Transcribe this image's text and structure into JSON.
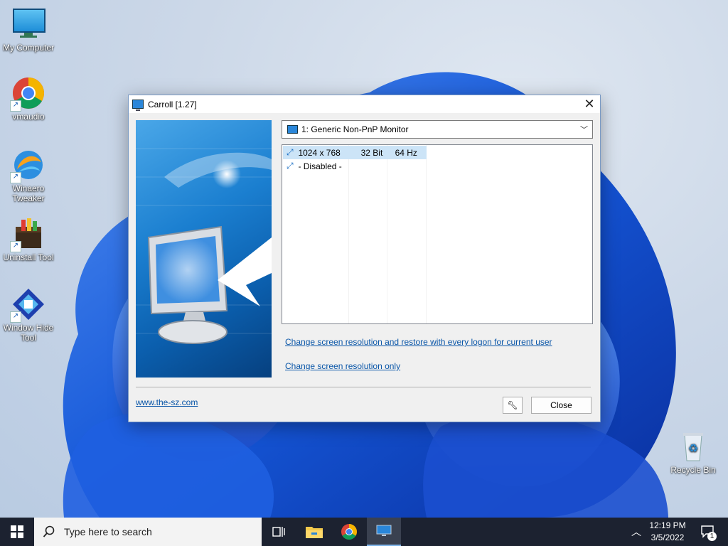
{
  "desktop": {
    "icons": [
      {
        "label": "My Computer",
        "icon": "monitor-icon"
      },
      {
        "label": "vmaudio",
        "icon": "chrome-icon"
      },
      {
        "label": "Winaero Tweaker",
        "icon": "winaero-icon"
      },
      {
        "label": "Uninstall Tool",
        "icon": "uninstall-tool-icon"
      },
      {
        "label": "Window Hide Tool",
        "icon": "window-hide-tool-icon"
      },
      {
        "label": "Recycle Bin",
        "icon": "recycle-bin-icon"
      }
    ]
  },
  "dialog": {
    "title": "Carroll [1.27]",
    "monitor_select": {
      "value": "1: Generic Non-PnP Monitor"
    },
    "resolutions": [
      {
        "res": "1024 x 768",
        "depth": "32 Bit",
        "hz": "64 Hz",
        "selected": true
      },
      {
        "res": "- Disabled -",
        "depth": "",
        "hz": "",
        "selected": false
      }
    ],
    "link_restore": "Change screen resolution and restore with every logon for current user",
    "link_only": "Change screen resolution only",
    "website": "www.the-sz.com",
    "close_button": "Close"
  },
  "taskbar": {
    "search_placeholder": "Type here to search",
    "time": "12:19 PM",
    "date": "3/5/2022",
    "notification_count": "1",
    "pinned": [
      "task-view-icon",
      "file-explorer-icon",
      "chrome-icon",
      "carroll-icon"
    ]
  },
  "colors": {
    "accent": "#0a56a8",
    "taskbar": "#1c2230",
    "selection": "#cce4f7"
  }
}
